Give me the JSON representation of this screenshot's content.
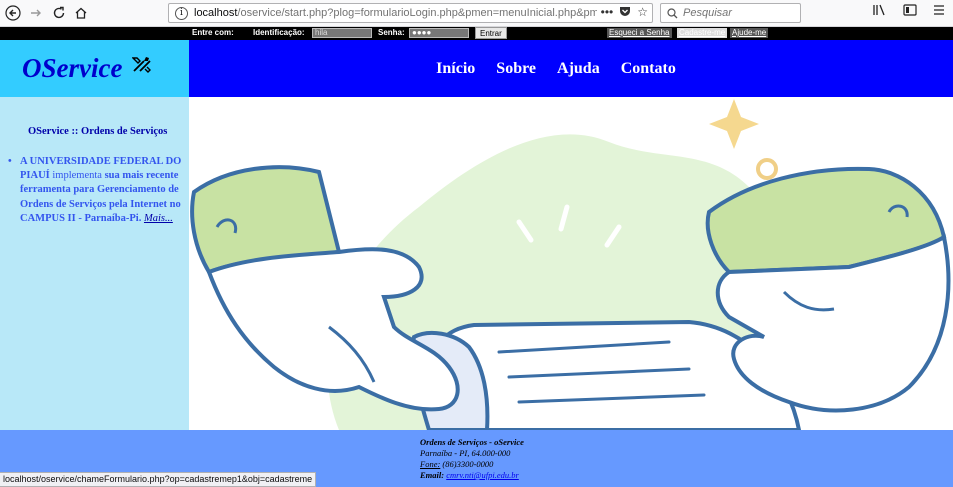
{
  "browser": {
    "url_host": "localhost",
    "url_path": "/oservice/start.php?plog=formularioLogin.php&pmen=menuInicial.php&pmur",
    "url_actions": "•••",
    "search_placeholder": "Pesquisar"
  },
  "loginbar": {
    "enter_label": "Entre com:",
    "id_label": "Identificação:",
    "id_value": "hila",
    "password_label": "Senha:",
    "password_value": "●●●●",
    "submit_label": "Entrar",
    "forgot_label": "Esqueci a Senha",
    "register_label": "Cadastre-me",
    "help_label": "Ajude-me"
  },
  "header": {
    "logo": "OService",
    "nav": [
      "Início",
      "Sobre",
      "Ajuda",
      "Contato"
    ]
  },
  "sidebar": {
    "title": "OService :: Ordens de Serviços",
    "item_part1": "A UNIVERSIDADE FEDERAL DO PIAUÍ",
    "item_part2": "implementa",
    "item_part3": "sua mais recente ferramenta para Gerenciamento de Ordens de Serviços pela Internet no CAMPUS II - Parnaíba-Pi.",
    "more_link": "Mais..."
  },
  "footer": {
    "title": "Ordens de Serviços - oService",
    "address": "Parnaíba - PI, 64.000-000",
    "phone_label": "Fone:",
    "phone": "(86)3300-0000",
    "email_label": "Email:",
    "email": "cmrv.nti@ufpi.edu.br"
  },
  "status_url": "localhost/oservice/chameFormulario.php?op=cadastremep1&obj=cadastreme",
  "colors": {
    "logo_bg": "#33ccff",
    "nav_bg": "#0000ff",
    "sidebar_bg": "#b8e8f8",
    "footer_bg": "#6699ff"
  }
}
